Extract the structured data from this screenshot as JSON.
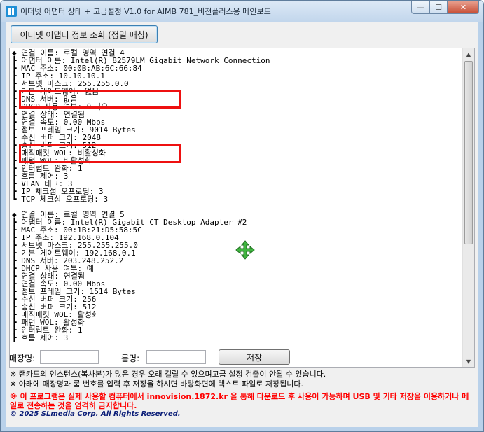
{
  "window": {
    "title": "이더넷 어댑터 상태 + 고급설정 V1.0 for AIMB 781_비전플러스용 메인보드",
    "minimize_glyph": "—",
    "maximize_glyph": "☐",
    "close_glyph": "✕"
  },
  "toolbar": {
    "query_label": "이더넷 어댑터 정보 조회 (정밀 매칭)"
  },
  "output": {
    "lines": [
      "◆ 연결 이름: 로컬 영역 연결 4",
      "┣ 어댑터 이름: Intel(R) 82579LM Gigabit Network Connection",
      "┣ MAC 주소: 00:0B:AB:6C:66:84",
      "┣ IP 주소: 10.10.10.1",
      "┣ 서브넷 마스크: 255.255.0.0",
      "┣ 기본 게이트웨이: 없음",
      "┣ DNS 서버: 없음",
      "┣ DHCP 사용 여부: 아니오",
      "┣ 연결 상태: 연결됨",
      "┣ 연결 속도: 0.00 Mbps",
      "┣ 점보 프레임 크기: 9014 Bytes",
      "┣ 수신 버퍼 크기: 2048",
      "┣ 송신 버퍼 크기: 512",
      "┣ 매직패킷 WOL: 비활성화",
      "┣ 패턴 WOL: 비활성화",
      "┣ 인터럽트 완화: 1",
      "┣ 흐름 제어: 3",
      "┣ VLAN 태그: 3",
      "┣ IP 체크섬 오프로딩: 3",
      "┗ TCP 체크섬 오프로딩: 3",
      "",
      "◆ 연결 이름: 로컬 영역 연결 5",
      "┣ 어댑터 이름: Intel(R) Gigabit CT Desktop Adapter #2",
      "┣ MAC 주소: 00:1B:21:D5:58:5C",
      "┣ IP 주소: 192.168.0.104",
      "┣ 서브넷 마스크: 255.255.255.0",
      "┣ 기본 게이트웨이: 192.168.0.1",
      "┣ DNS 서버: 203.248.252.2",
      "┣ DHCP 사용 여부: 예",
      "┣ 연결 상태: 연결됨",
      "┣ 연결 속도: 0.00 Mbps",
      "┣ 점보 프레임 크기: 1514 Bytes",
      "┣ 수신 버퍼 크기: 256",
      "┣ 송신 버퍼 크기: 512",
      "┣ 매직패킷 WOL: 활성화",
      "┣ 패턴 WOL: 활성화",
      "┣ 인터럽트 완화: 1",
      "┣ 흐름 제어: 3"
    ]
  },
  "form": {
    "store_label": "매장명:",
    "store_value": "",
    "room_label": "룸명:",
    "room_value": "",
    "save_label": "저장"
  },
  "notes": {
    "note1": "※ 랜카드의 인스턴스(복사본)가 많은 경우 오래 걸릴 수 있으며고급 설정 검출이 안될 수 있습니다.",
    "note2": "※ 아래에 매장명과 룸 번호를 입력 후 저장을 하시면 바탕화면에 텍스트 파일로 저장됩니다.",
    "warning": "※ 이 프로그램은 실제 사용할 컴퓨터에서 innovision.1872.kr 을 통해 다운로드 후 사용이 가능하며 USB 및 기타 저장을 이용하거나 메일로 전송하는 것을 엄격히 금지합니다.",
    "copyright": "© 2025 SLmedia Corp. All Rights Reserved."
  },
  "colors": {
    "highlight": "#ee1010",
    "warning_text": "#ff0000",
    "copyright_text": "#0b1e78",
    "cursor": "#3fb53f"
  },
  "icons": {
    "app": "network-adapter-icon",
    "cursor": "move-cursor-icon",
    "scroll_up": "scroll-up-arrow-icon",
    "scroll_down": "scroll-down-arrow-icon"
  }
}
